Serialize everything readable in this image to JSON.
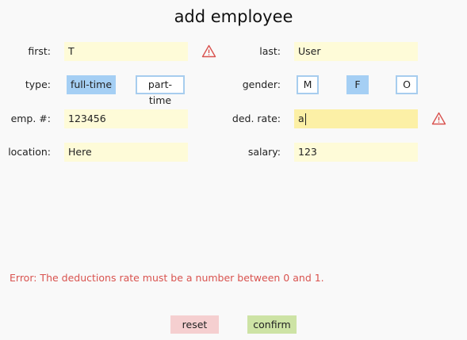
{
  "title": "add employee",
  "labels": {
    "first": "first:",
    "last": "last:",
    "type": "type:",
    "gender": "gender:",
    "emp_num": "emp. #:",
    "ded_rate": "ded. rate:",
    "location": "location:",
    "salary": "salary:"
  },
  "fields": {
    "first": "T",
    "last": "User",
    "emp_num": "123456",
    "ded_rate": "a",
    "location": "Here",
    "salary": "123"
  },
  "type_options": [
    "full-time",
    "part-time"
  ],
  "type_selected": "full-time",
  "gender_options": [
    "M",
    "F",
    "O"
  ],
  "gender_selected": "F",
  "error": "Error: The deductions rate must be a number between 0 and 1.",
  "actions": {
    "reset": "reset",
    "confirm": "confirm"
  },
  "colors": {
    "field_bg": "#fefbd8",
    "field_focus_bg": "#fcf0a6",
    "selected_bg": "#a5cff4",
    "option_border": "#a7cdee",
    "error": "#d9534f",
    "reset_bg": "#f5cfd0",
    "confirm_bg": "#cde3a5"
  },
  "icons": {
    "warning": "warning-triangle-icon"
  }
}
